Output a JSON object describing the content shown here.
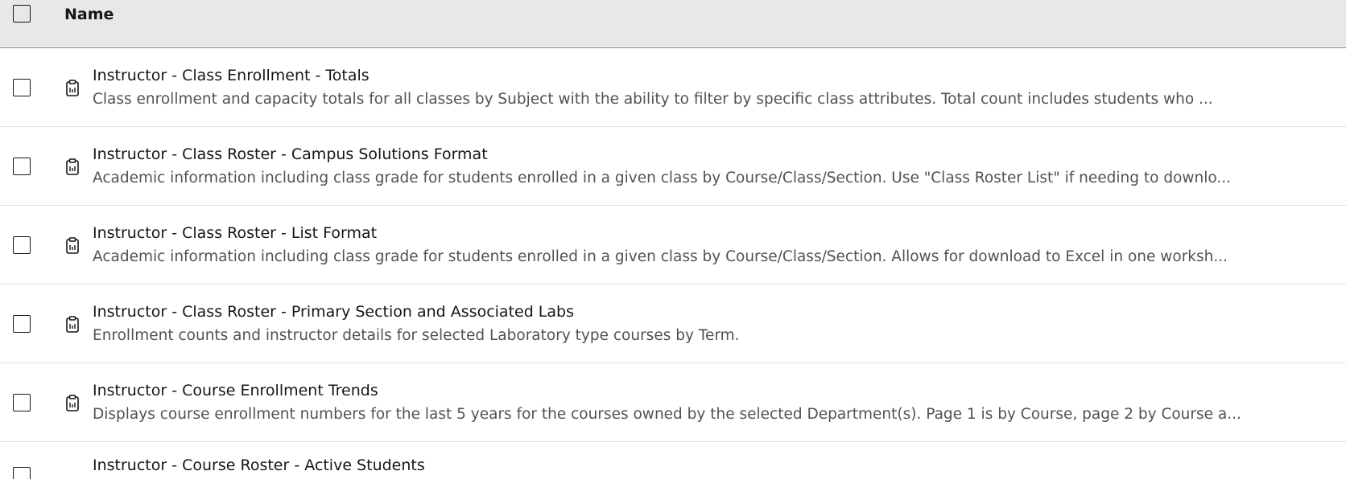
{
  "header": {
    "name_label": "Name"
  },
  "rows": [
    {
      "title": "Instructor - Class Enrollment - Totals",
      "description": "Class enrollment and capacity totals for all classes by Subject with the ability to filter by specific class attributes. Total count includes students who ..."
    },
    {
      "title": "Instructor - Class Roster - Campus Solutions Format",
      "description": "Academic information including class grade for students enrolled in a given class by Course/Class/Section. Use \"Class Roster List\" if needing to downlo..."
    },
    {
      "title": "Instructor - Class Roster - List Format",
      "description": "Academic information including class grade for students enrolled in a given class by Course/Class/Section. Allows for download to Excel in one worksh..."
    },
    {
      "title": "Instructor - Class Roster - Primary Section and Associated Labs",
      "description": "Enrollment counts and instructor details for selected Laboratory type courses by Term."
    },
    {
      "title": "Instructor - Course Enrollment Trends",
      "description": "Displays course enrollment numbers for the last 5 years for the courses owned by the selected Department(s). Page 1 is by Course, page 2 by Course a..."
    },
    {
      "title": "Instructor - Course Roster - Active Students",
      "description": ""
    }
  ],
  "icons": {
    "row_icon": "report-clipboard-icon"
  }
}
